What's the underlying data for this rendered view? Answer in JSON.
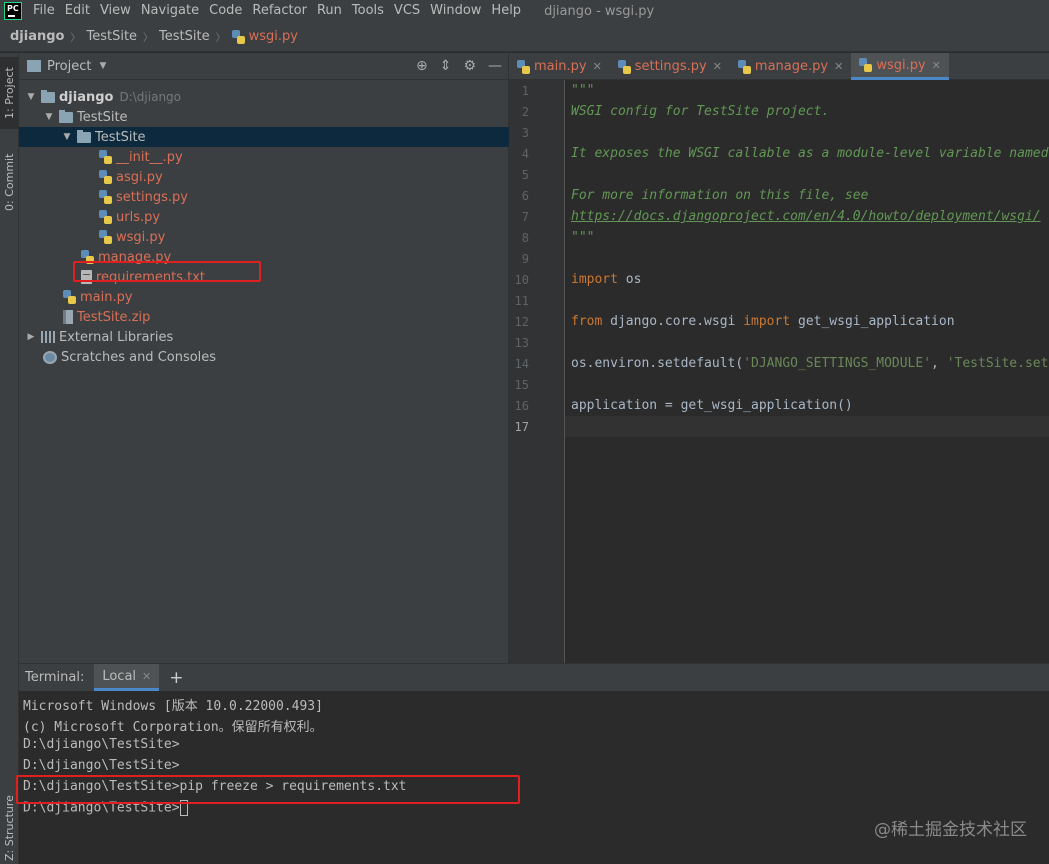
{
  "menubar": {
    "items": [
      "File",
      "Edit",
      "View",
      "Navigate",
      "Code",
      "Refactor",
      "Run",
      "Tools",
      "VCS",
      "Window",
      "Help"
    ],
    "window_title": "djiango - wsgi.py"
  },
  "breadcrumb": [
    "djiango",
    "TestSite",
    "TestSite",
    "wsgi.py"
  ],
  "left_strip": {
    "project_tab": "1: Project",
    "commit_tab": "0: Commit",
    "structure_tab": "Z: Structure"
  },
  "project_panel": {
    "title": "Project",
    "tree": [
      {
        "label": "djiango",
        "hint": "D:\\djiango"
      },
      {
        "label": "TestSite"
      },
      {
        "label": "TestSite"
      },
      {
        "label": "__init__.py"
      },
      {
        "label": "asgi.py"
      },
      {
        "label": "settings.py"
      },
      {
        "label": "urls.py"
      },
      {
        "label": "wsgi.py"
      },
      {
        "label": "manage.py"
      },
      {
        "label": "requirements.txt"
      },
      {
        "label": "main.py"
      },
      {
        "label": "TestSite.zip"
      },
      {
        "label": "External Libraries"
      },
      {
        "label": "Scratches and Consoles"
      }
    ]
  },
  "editor": {
    "tabs": [
      "main.py",
      "settings.py",
      "manage.py",
      "wsgi.py"
    ],
    "active_tab": "wsgi.py",
    "line_numbers": [
      "1",
      "2",
      "3",
      "4",
      "5",
      "6",
      "7",
      "8",
      "9",
      "10",
      "11",
      "12",
      "13",
      "14",
      "15",
      "16",
      "17"
    ],
    "code": {
      "l1": "\"\"\"",
      "l2": "WSGI config for TestSite project.",
      "l4": "It exposes the WSGI callable as a module-level variable named ``application``.",
      "l6": "For more information on this file, see",
      "l7": "https://docs.djangoproject.com/en/4.0/howto/deployment/wsgi/",
      "l8": "\"\"\"",
      "l10_kw": "import",
      "l10_rest": " os",
      "l12_kw1": "from",
      "l12_mid": " django.core.wsgi ",
      "l12_kw2": "import",
      "l12_rest": " get_wsgi_application",
      "l14_a": "os.environ.setdefault(",
      "l14_s1": "'DJANGO_SETTINGS_MODULE'",
      "l14_b": ", ",
      "l14_s2": "'TestSite.settings'",
      "l14_c": ")",
      "l16": "application = get_wsgi_application()"
    }
  },
  "terminal": {
    "label": "Terminal:",
    "tab": "Local",
    "lines": [
      "Microsoft Windows [版本 10.0.22000.493]",
      "(c) Microsoft Corporation。保留所有权利。",
      "D:\\djiango\\TestSite>",
      "D:\\djiango\\TestSite>",
      "D:\\djiango\\TestSite>pip freeze > requirements.txt",
      "D:\\djiango\\TestSite>"
    ],
    "watermark": "@稀土掘金技术社区"
  }
}
